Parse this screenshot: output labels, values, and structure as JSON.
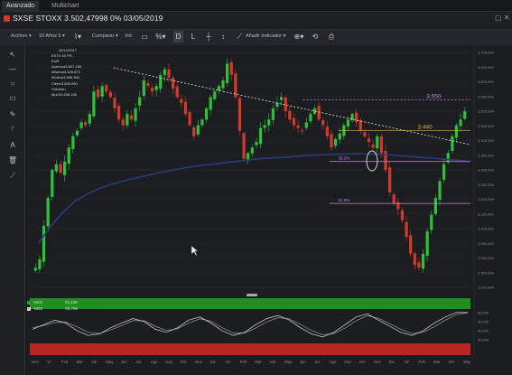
{
  "tabs": [
    {
      "label": "Avanzado",
      "active": true
    },
    {
      "label": "Multichart",
      "active": false
    }
  ],
  "title": {
    "text": "SXSE STOXX 3.502,47998 0% 03/05/2019",
    "winctl": "▢ ✕"
  },
  "toolbar": {
    "archivo": "Archivo ▾",
    "periodo": "10 Años 5 ▾",
    "chart_type_icon": "⌇▾",
    "comparar": "Comparar ▾",
    "vs": "Vol.",
    "box_icon": "▭",
    "pct": "%▾",
    "d": "D",
    "l": "L",
    "plus": "┼",
    "seg": "↕",
    "draw_icon": "⟋",
    "anadir": "Añadir Indicador ▾",
    "zoom_icon": "⊕▾",
    "refresh_icon": "⟲",
    "print_icon": "⎙"
  },
  "info_box": {
    "date": "20/10/2017",
    "instrument": "ESTX 50 PR. EUR",
    "rows": [
      {
        "label": "Apertura",
        "value": "3.607.180"
      },
      {
        "label": "Máximo",
        "value": "3.625.870"
      },
      {
        "label": "Mínimo",
        "value": "3.596.350"
      },
      {
        "label": "Cierre",
        "value": "3.605.090"
      },
      {
        "label": "Volumen",
        "value": ""
      },
      {
        "label": "MovS",
        "value": "3.256.240"
      }
    ]
  },
  "levels": [
    {
      "label": "3.550",
      "color": "#c58bd8",
      "value": 3550
    },
    {
      "label": "3.440",
      "color": "#d9b34a",
      "value": 3440
    },
    {
      "label": "38.2%",
      "color": "#c58bd8",
      "value": 3330
    },
    {
      "label": "61.8%",
      "color": "#c58bd8",
      "value": 3180
    }
  ],
  "indicator_legend": [
    {
      "name": "%KS",
      "value": "94,108",
      "color": "#2f9e2f"
    },
    {
      "name": "%DS",
      "value": "93,786",
      "color": "#d0d0d0"
    }
  ],
  "colors": {
    "up": "#2fbf3a",
    "down": "#d23b2b",
    "ma": "#2b3a7a",
    "trend": "#e6e6e6"
  },
  "chart_data": {
    "type": "candlestick",
    "y_axis_labels": [
      "3.700,000",
      "3.650,000",
      "3.600,000",
      "3.550,000",
      "3.500,000",
      "3.450,000",
      "3.400,000",
      "3.350,000",
      "3.300,000",
      "3.250,000",
      "3.200,000",
      "3.150,000",
      "3.100,000",
      "3.050,000",
      "3.000,000",
      "2.950,000",
      "2.900,000"
    ],
    "ylim": [
      2880,
      3720
    ],
    "x_axis_labels": [
      "Nov",
      "'17",
      "Feb",
      "Mar",
      "Abr",
      "May",
      "Jun",
      "Jul",
      "Ago",
      "Sep",
      "Oct",
      "Nov",
      "Dic",
      "'18",
      "Feb",
      "Mar",
      "Abr",
      "May",
      "Jun",
      "Jul",
      "Ago",
      "Sep",
      "Oct",
      "Nov",
      "Dic",
      "'19",
      "Feb",
      "Mar",
      "Abr",
      "May"
    ],
    "close_path": [
      2950,
      2980,
      3100,
      3200,
      3300,
      3320,
      3290,
      3330,
      3380,
      3420,
      3440,
      3470,
      3460,
      3500,
      3580,
      3560,
      3600,
      3580,
      3560,
      3520,
      3480,
      3460,
      3500,
      3480,
      3520,
      3560,
      3620,
      3600,
      3580,
      3600,
      3640,
      3660,
      3630,
      3590,
      3560,
      3540,
      3500,
      3460,
      3420,
      3460,
      3480,
      3520,
      3560,
      3580,
      3600,
      3620,
      3680,
      3640,
      3560,
      3440,
      3340,
      3360,
      3380,
      3400,
      3450,
      3460,
      3480,
      3520,
      3540,
      3560,
      3510,
      3480,
      3460,
      3450,
      3440,
      3470,
      3500,
      3520,
      3480,
      3460,
      3420,
      3380,
      3410,
      3430,
      3460,
      3480,
      3500,
      3470,
      3440,
      3420,
      3400,
      3380,
      3420,
      3360,
      3300,
      3220,
      3180,
      3160,
      3120,
      3060,
      3000,
      2960,
      2950,
      3000,
      3080,
      3140,
      3200,
      3260,
      3320,
      3360,
      3420,
      3460,
      3480,
      3510
    ],
    "ma_path": [
      3040,
      3100,
      3150,
      3190,
      3215,
      3235,
      3250,
      3262,
      3272,
      3282,
      3292,
      3300,
      3308,
      3315,
      3320,
      3325,
      3330,
      3335,
      3340,
      3343,
      3345,
      3348,
      3352,
      3354,
      3356,
      3357,
      3358,
      3357,
      3355,
      3352,
      3348,
      3345,
      3342,
      3338,
      3335,
      3330
    ],
    "trendline": {
      "from": [
        0.19,
        3665
      ],
      "to": [
        1.0,
        3390
      ]
    },
    "stoch_k": [
      40,
      55,
      70,
      60,
      35,
      20,
      25,
      45,
      60,
      75,
      65,
      40,
      30,
      45,
      70,
      80,
      60,
      35,
      20,
      30,
      55,
      75,
      85,
      70,
      45,
      25,
      15,
      30,
      55,
      80,
      90,
      70,
      50,
      30,
      20,
      35,
      60,
      80,
      95,
      94
    ],
    "stoch_d": [
      45,
      52,
      62,
      63,
      48,
      30,
      26,
      38,
      52,
      68,
      68,
      50,
      36,
      42,
      60,
      74,
      66,
      45,
      28,
      28,
      44,
      64,
      78,
      74,
      56,
      36,
      22,
      26,
      44,
      68,
      84,
      76,
      58,
      40,
      26,
      30,
      48,
      70,
      88,
      94
    ],
    "stoch_axis": [
      "80,000",
      "60,000",
      "40,000",
      "20,000"
    ]
  }
}
